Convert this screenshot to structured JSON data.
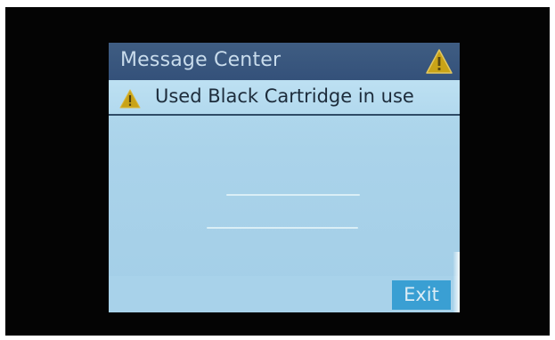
{
  "title_bar": {
    "title": "Message Center",
    "icon": "warning-triangle-icon"
  },
  "message": {
    "icon": "warning-triangle-icon",
    "text": "Used Black Cartridge in use"
  },
  "actions": {
    "exit_label": "Exit"
  },
  "colors": {
    "title_bar": "#3a5780",
    "title_text": "#c9dcec",
    "screen_background": "#aad3ea",
    "warning_yellow": "#c9a317",
    "exit_button": "#3a9fd3"
  }
}
